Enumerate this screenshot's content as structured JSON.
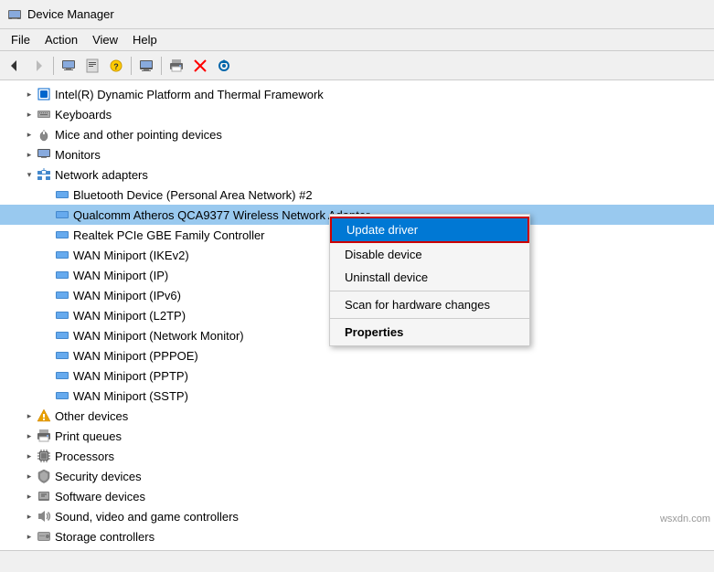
{
  "titleBar": {
    "title": "Device Manager",
    "icon": "device-manager-icon"
  },
  "menuBar": {
    "items": [
      "File",
      "Action",
      "View",
      "Help"
    ]
  },
  "toolbar": {
    "buttons": [
      {
        "name": "back-button",
        "icon": "◀",
        "label": "Back"
      },
      {
        "name": "forward-button",
        "icon": "▶",
        "label": "Forward"
      },
      {
        "name": "toolbar-sep1",
        "type": "separator"
      },
      {
        "name": "properties-button",
        "icon": "⊞",
        "label": "Properties"
      },
      {
        "name": "update-driver-button",
        "icon": "⊡",
        "label": "Update driver"
      },
      {
        "name": "help-button",
        "icon": "?",
        "label": "Help"
      },
      {
        "name": "toolbar-sep2",
        "type": "separator"
      },
      {
        "name": "monitor-button",
        "icon": "🖥",
        "label": "Monitor"
      },
      {
        "name": "toolbar-sep3",
        "type": "separator"
      },
      {
        "name": "print-button",
        "icon": "🖨",
        "label": "Print"
      },
      {
        "name": "delete-button",
        "icon": "✕",
        "label": "Delete"
      },
      {
        "name": "refresh-button",
        "icon": "⊕",
        "label": "Refresh"
      }
    ]
  },
  "tree": {
    "items": [
      {
        "id": "intel-dynamic",
        "level": 1,
        "expand": "collapsed",
        "icon": "cpu-icon",
        "label": "Intel(R) Dynamic Platform and Thermal Framework"
      },
      {
        "id": "keyboards",
        "level": 1,
        "expand": "collapsed",
        "icon": "keyboard-icon",
        "label": "Keyboards"
      },
      {
        "id": "mice",
        "level": 1,
        "expand": "collapsed",
        "icon": "mouse-icon",
        "label": "Mice and other pointing devices"
      },
      {
        "id": "monitors",
        "level": 1,
        "expand": "collapsed",
        "icon": "monitor-icon",
        "label": "Monitors"
      },
      {
        "id": "network-adapters",
        "level": 1,
        "expand": "expanded",
        "icon": "network-icon",
        "label": "Network adapters"
      },
      {
        "id": "bluetooth",
        "level": 2,
        "expand": "none",
        "icon": "network-child-icon",
        "label": "Bluetooth Device (Personal Area Network) #2"
      },
      {
        "id": "qualcomm",
        "level": 2,
        "expand": "none",
        "icon": "network-child-icon",
        "label": "Qualcomm Atheros QCA9377 Wireless Network Adapter",
        "selected": true
      },
      {
        "id": "realtek",
        "level": 2,
        "expand": "none",
        "icon": "network-child-icon",
        "label": "Realtek PCIe GBE Family Controller"
      },
      {
        "id": "wan-ikev2",
        "level": 2,
        "expand": "none",
        "icon": "network-child-icon",
        "label": "WAN Miniport (IKEv2)"
      },
      {
        "id": "wan-ip",
        "level": 2,
        "expand": "none",
        "icon": "network-child-icon",
        "label": "WAN Miniport (IP)"
      },
      {
        "id": "wan-ipv6",
        "level": 2,
        "expand": "none",
        "icon": "network-child-icon",
        "label": "WAN Miniport (IPv6)"
      },
      {
        "id": "wan-l2tp",
        "level": 2,
        "expand": "none",
        "icon": "network-child-icon",
        "label": "WAN Miniport (L2TP)"
      },
      {
        "id": "wan-netmon",
        "level": 2,
        "expand": "none",
        "icon": "network-child-icon",
        "label": "WAN Miniport (Network Monitor)"
      },
      {
        "id": "wan-pppoe",
        "level": 2,
        "expand": "none",
        "icon": "network-child-icon",
        "label": "WAN Miniport (PPPOE)"
      },
      {
        "id": "wan-pptp",
        "level": 2,
        "expand": "none",
        "icon": "network-child-icon",
        "label": "WAN Miniport (PPTP)"
      },
      {
        "id": "wan-sstp",
        "level": 2,
        "expand": "none",
        "icon": "network-child-icon",
        "label": "WAN Miniport (SSTP)"
      },
      {
        "id": "other-devices",
        "level": 1,
        "expand": "collapsed",
        "icon": "warn-icon",
        "label": "Other devices"
      },
      {
        "id": "print-queues",
        "level": 1,
        "expand": "collapsed",
        "icon": "print-icon",
        "label": "Print queues"
      },
      {
        "id": "processors",
        "level": 1,
        "expand": "collapsed",
        "icon": "cpu2-icon",
        "label": "Processors"
      },
      {
        "id": "security-devices",
        "level": 1,
        "expand": "collapsed",
        "icon": "security-icon",
        "label": "Security devices"
      },
      {
        "id": "software-devices",
        "level": 1,
        "expand": "collapsed",
        "icon": "software-icon",
        "label": "Software devices"
      },
      {
        "id": "sound-video",
        "level": 1,
        "expand": "collapsed",
        "icon": "sound-icon",
        "label": "Sound, video and game controllers"
      },
      {
        "id": "storage-controllers",
        "level": 1,
        "expand": "collapsed",
        "icon": "storage-icon",
        "label": "Storage controllers"
      }
    ]
  },
  "contextMenu": {
    "items": [
      {
        "id": "update-driver",
        "label": "Update driver",
        "type": "active"
      },
      {
        "id": "disable-device",
        "label": "Disable device",
        "type": "normal"
      },
      {
        "id": "uninstall-device",
        "label": "Uninstall device",
        "type": "normal"
      },
      {
        "id": "sep1",
        "type": "separator"
      },
      {
        "id": "scan-hardware",
        "label": "Scan for hardware changes",
        "type": "normal"
      },
      {
        "id": "sep2",
        "type": "separator"
      },
      {
        "id": "properties",
        "label": "Properties",
        "type": "bold"
      }
    ]
  },
  "statusBar": {
    "text": ""
  },
  "watermark": "wsxdn.com"
}
